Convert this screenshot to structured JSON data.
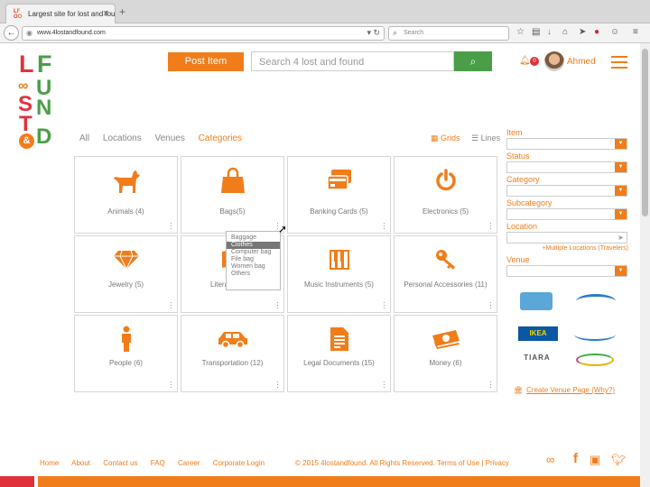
{
  "browser": {
    "tab_title": "Largest site for lost and fou...",
    "new_tab": "+",
    "url": "www.4lostandfound.com",
    "search_placeholder": "Search"
  },
  "logo": {
    "letters": [
      "L",
      "F",
      "O",
      "O",
      "S",
      "U",
      "T",
      "N",
      "&",
      "D"
    ],
    "colors": {
      "L": "#e0313b",
      "F": "#f07d1a",
      "S": "#e0313b",
      "U": "#4a9e47",
      "T": "#e0313b",
      "N": "#4a9e47",
      "D": "#4a9e47"
    }
  },
  "header": {
    "post_label": "Post Item",
    "search_placeholder": "Search 4 lost and found",
    "notif_count": "0",
    "user_name": "Ahmed"
  },
  "filters": {
    "items": [
      "All",
      "Locations",
      "Venues",
      "Categories"
    ],
    "active": "Categories",
    "view_grid": "Grids",
    "view_lines": "Lines"
  },
  "categories": [
    {
      "label": "Animals (4)",
      "icon": "dog-icon"
    },
    {
      "label": "Bags(5)",
      "icon": "bag-icon"
    },
    {
      "label": "Banking Cards (5)",
      "icon": "cards-icon"
    },
    {
      "label": "Electronics (5)",
      "icon": "power-icon"
    },
    {
      "label": "Jewelry (5)",
      "icon": "diamond-icon"
    },
    {
      "label": "Litera",
      "icon": "book-icon"
    },
    {
      "label": "Music Instruments (5)",
      "icon": "piano-icon"
    },
    {
      "label": "Personal Accessories (11)",
      "icon": "key-icon"
    },
    {
      "label": "People (6)",
      "icon": "person-icon"
    },
    {
      "label": "Transportation  (12)",
      "icon": "car-icon"
    },
    {
      "label": "Legal Documents (15)",
      "icon": "document-icon"
    },
    {
      "label": "Money (6)",
      "icon": "money-icon"
    }
  ],
  "bag_dropdown": [
    "Baggage",
    "Clothes",
    "Computer bag",
    "File bag",
    "Women bag",
    "Others"
  ],
  "bag_dropdown_selected": "Clothes",
  "sidebar": {
    "item_label": "Item",
    "status_label": "Status",
    "category_label": "Category",
    "subcategory_label": "Subcategory",
    "location_label": "Location",
    "multiple_locations": "+Multiple Locations (Travelers)",
    "venue_label": "Venue",
    "partners": [
      "IKEA",
      "TIARA"
    ],
    "venue_link": "Create Venue Page (Why?)"
  },
  "footer": {
    "links": [
      "Home",
      "About",
      "Contact us",
      "FAQ",
      "Career",
      "Corporate Login"
    ],
    "copyright": "© 2015 4lostandfound. All Rights Reserved.",
    "terms": "Terms of Use",
    "privacy": "Privacy"
  },
  "colors": {
    "accent": "#f07d1a",
    "green": "#4a9e47",
    "red": "#e0313b"
  }
}
